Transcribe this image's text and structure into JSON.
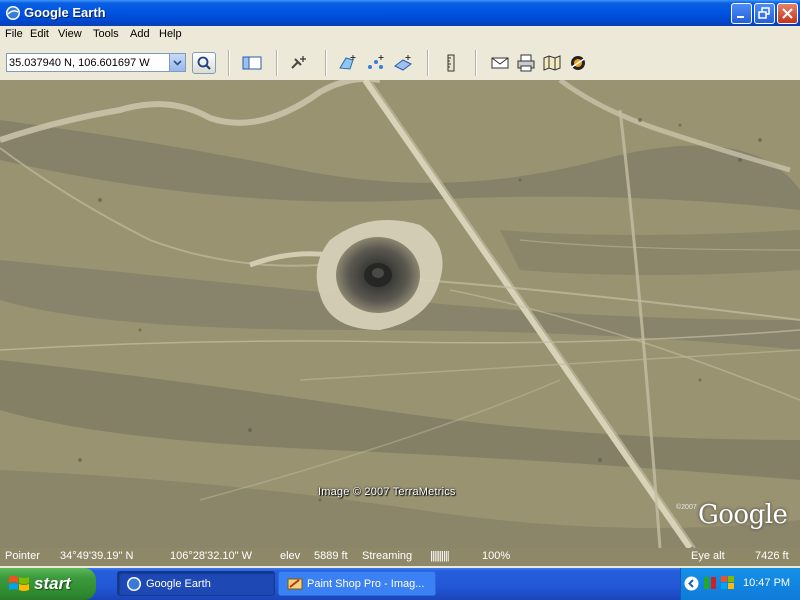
{
  "window": {
    "title": "Google Earth"
  },
  "menu": [
    "File",
    "Edit",
    "View",
    "Tools",
    "Add",
    "Help"
  ],
  "search": {
    "value": "35.037940 N, 106.601697 W"
  },
  "toolbar_icons": [
    "sidebar-toggle-icon",
    "placemark-add-icon",
    "polygon-add-icon",
    "path-add-icon",
    "image-overlay-add-icon",
    "ruler-icon",
    "email-icon",
    "print-icon",
    "google-maps-icon",
    "sky-toggle-icon"
  ],
  "map": {
    "copyright": "Image © 2007 TerraMetrics",
    "logo_small": "©2007",
    "logo": "Google"
  },
  "status": {
    "pointer_label": "Pointer",
    "lat": "34°49'39.19\" N",
    "lon": "106°28'32.10\" W",
    "elev_label": "elev",
    "elev": "5889 ft",
    "streaming_label": "Streaming",
    "streaming_bars": "||||||||||",
    "streaming_pct": "100%",
    "eye_label": "Eye alt",
    "eye_alt": "7426 ft"
  },
  "taskbar": {
    "start": "start",
    "tasks": [
      "Google Earth",
      "Paint Shop Pro - Imag..."
    ],
    "clock": "10:47 PM"
  },
  "colors": {
    "title_blue": "#0054e3",
    "taskbar_blue": "#245edb",
    "start_green": "#3c9a3c",
    "terrain": "#9a9372"
  }
}
